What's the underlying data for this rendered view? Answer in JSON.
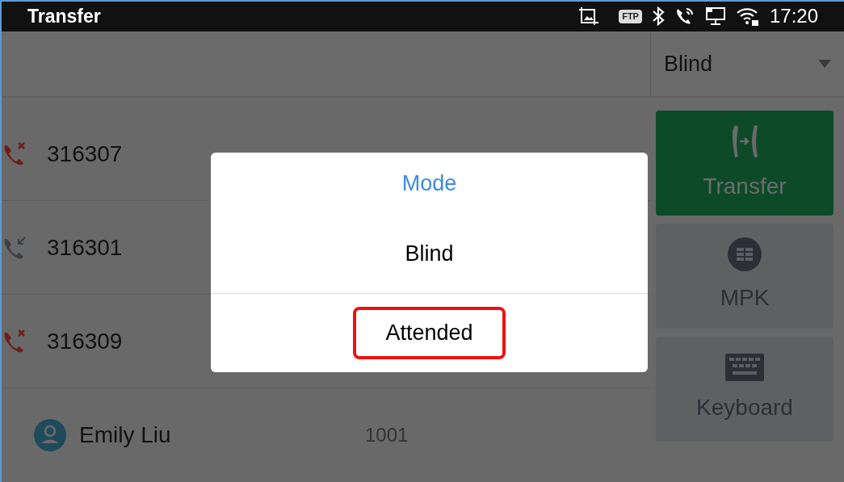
{
  "status_bar": {
    "title": "Transfer",
    "time": "17:20",
    "ftp_badge": "FTP"
  },
  "mode_dropdown": {
    "value": "Blind"
  },
  "calls": [
    {
      "kind": "missed",
      "name": "316307"
    },
    {
      "kind": "received",
      "name": "316301"
    },
    {
      "kind": "missed",
      "name": "316309"
    },
    {
      "kind": "contact",
      "name": "Emily Liu",
      "number": "1001"
    }
  ],
  "side_buttons": [
    {
      "kind": "transfer",
      "label": "Transfer",
      "active": true
    },
    {
      "kind": "mpk",
      "label": "MPK",
      "active": false
    },
    {
      "kind": "keyboard",
      "label": "Keyboard",
      "active": false
    }
  ],
  "dialog": {
    "title": "Mode",
    "options": [
      {
        "label": "Blind",
        "highlighted": false
      },
      {
        "label": "Attended",
        "highlighted": true
      }
    ]
  }
}
